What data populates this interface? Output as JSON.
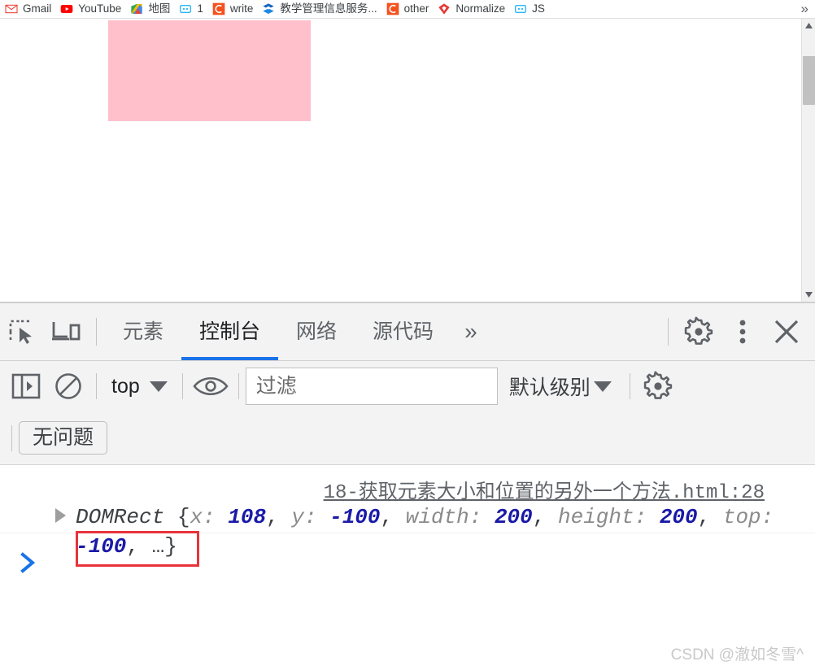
{
  "browser": {
    "bookmarks": [
      {
        "label": "Gmail",
        "icon": "gmail-icon"
      },
      {
        "label": "YouTube",
        "icon": "youtube-icon"
      },
      {
        "label": "地图",
        "icon": "google-maps-icon"
      },
      {
        "label": "1",
        "icon": "blue-square-icon"
      },
      {
        "label": "write",
        "icon": "orange-c-icon"
      },
      {
        "label": "教学管理信息服务...",
        "icon": "blue-badge-icon"
      },
      {
        "label": "other",
        "icon": "orange-c-icon"
      },
      {
        "label": "Normalize",
        "icon": "red-diamond-icon"
      },
      {
        "label": "JS",
        "icon": "blue-square-icon"
      }
    ],
    "overflow_label": "»"
  },
  "page": {
    "pink_box_color": "#ffc0cb",
    "scrollbar": {
      "up_arrow_icon": "scroll-up-arrow-icon",
      "down_arrow_icon": "scroll-down-arrow-icon"
    }
  },
  "devtools": {
    "left_icons": [
      {
        "name": "inspect-element-icon"
      },
      {
        "name": "device-toolbar-icon"
      }
    ],
    "tabs": [
      {
        "label": "元素",
        "active": false
      },
      {
        "label": "控制台",
        "active": true
      },
      {
        "label": "网络",
        "active": false
      },
      {
        "label": "源代码",
        "active": false
      }
    ],
    "more_tabs_label": "»",
    "right_icons": [
      {
        "name": "settings-gear-icon"
      },
      {
        "name": "more-options-icon"
      },
      {
        "name": "close-icon"
      }
    ],
    "console_toolbar": {
      "sidebar_toggle_icon": "console-sidebar-toggle-icon",
      "clear_console_icon": "clear-console-icon",
      "context_value": "top",
      "eye_icon": "live-expression-eye-icon",
      "filter_placeholder": "过滤",
      "filter_value": "",
      "level_label": "默认级别",
      "settings_icon": "console-settings-gear-icon",
      "issues_label": "无问题"
    },
    "console_output": {
      "source_link": "18-获取元素大小和位置的另外一个方法.html:28",
      "expander_icon": "expand-triangle-icon",
      "object_type": "DOMRect",
      "open_brace": "{",
      "properties": [
        {
          "key": "x",
          "value": "108"
        },
        {
          "key": "y",
          "value": "-100"
        },
        {
          "key": "width",
          "value": "200"
        },
        {
          "key": "height",
          "value": "200"
        },
        {
          "key": "top",
          "value": "-100"
        }
      ],
      "ellipsis": "…",
      "close_brace": "}",
      "highlight_color": "#e8333a",
      "prompt_icon": "console-prompt-chevron-icon"
    }
  },
  "watermark": "CSDN @澈如冬雪^"
}
